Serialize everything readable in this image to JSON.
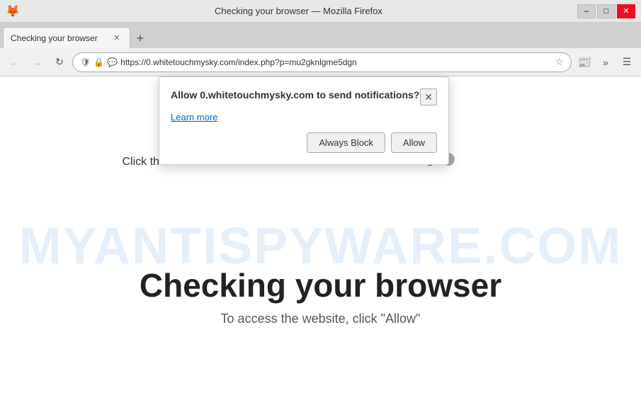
{
  "titlebar": {
    "title": "Checking your browser — Mozilla Firefox",
    "logo_symbol": "🦊",
    "minimize_label": "–",
    "maximize_label": "□",
    "close_label": "✕"
  },
  "tabbar": {
    "tab_title": "Checking your browser",
    "tab_close": "✕",
    "new_tab": "+"
  },
  "navbar": {
    "back": "←",
    "forward": "→",
    "refresh": "↻",
    "url": "https://0.whitetouchmysky.com/index.php?p=mu2gknlgme5dgn",
    "star": "☆",
    "extensions": "»",
    "menu": "☰"
  },
  "popup": {
    "title": "Allow 0.whitetouchmysky.com to send notifications?",
    "learn_more": "Learn more",
    "close_icon": "✕",
    "always_block_label": "Always Block",
    "allow_label": "Allow"
  },
  "watermark": {
    "line1": "MYANTISPYWARE.COM"
  },
  "page": {
    "arrow_up": "↑",
    "click_instruction": "Click the \"Allow\" button",
    "heading": "Checking your browser",
    "sub_text": "To access the website, click \"Allow\""
  }
}
